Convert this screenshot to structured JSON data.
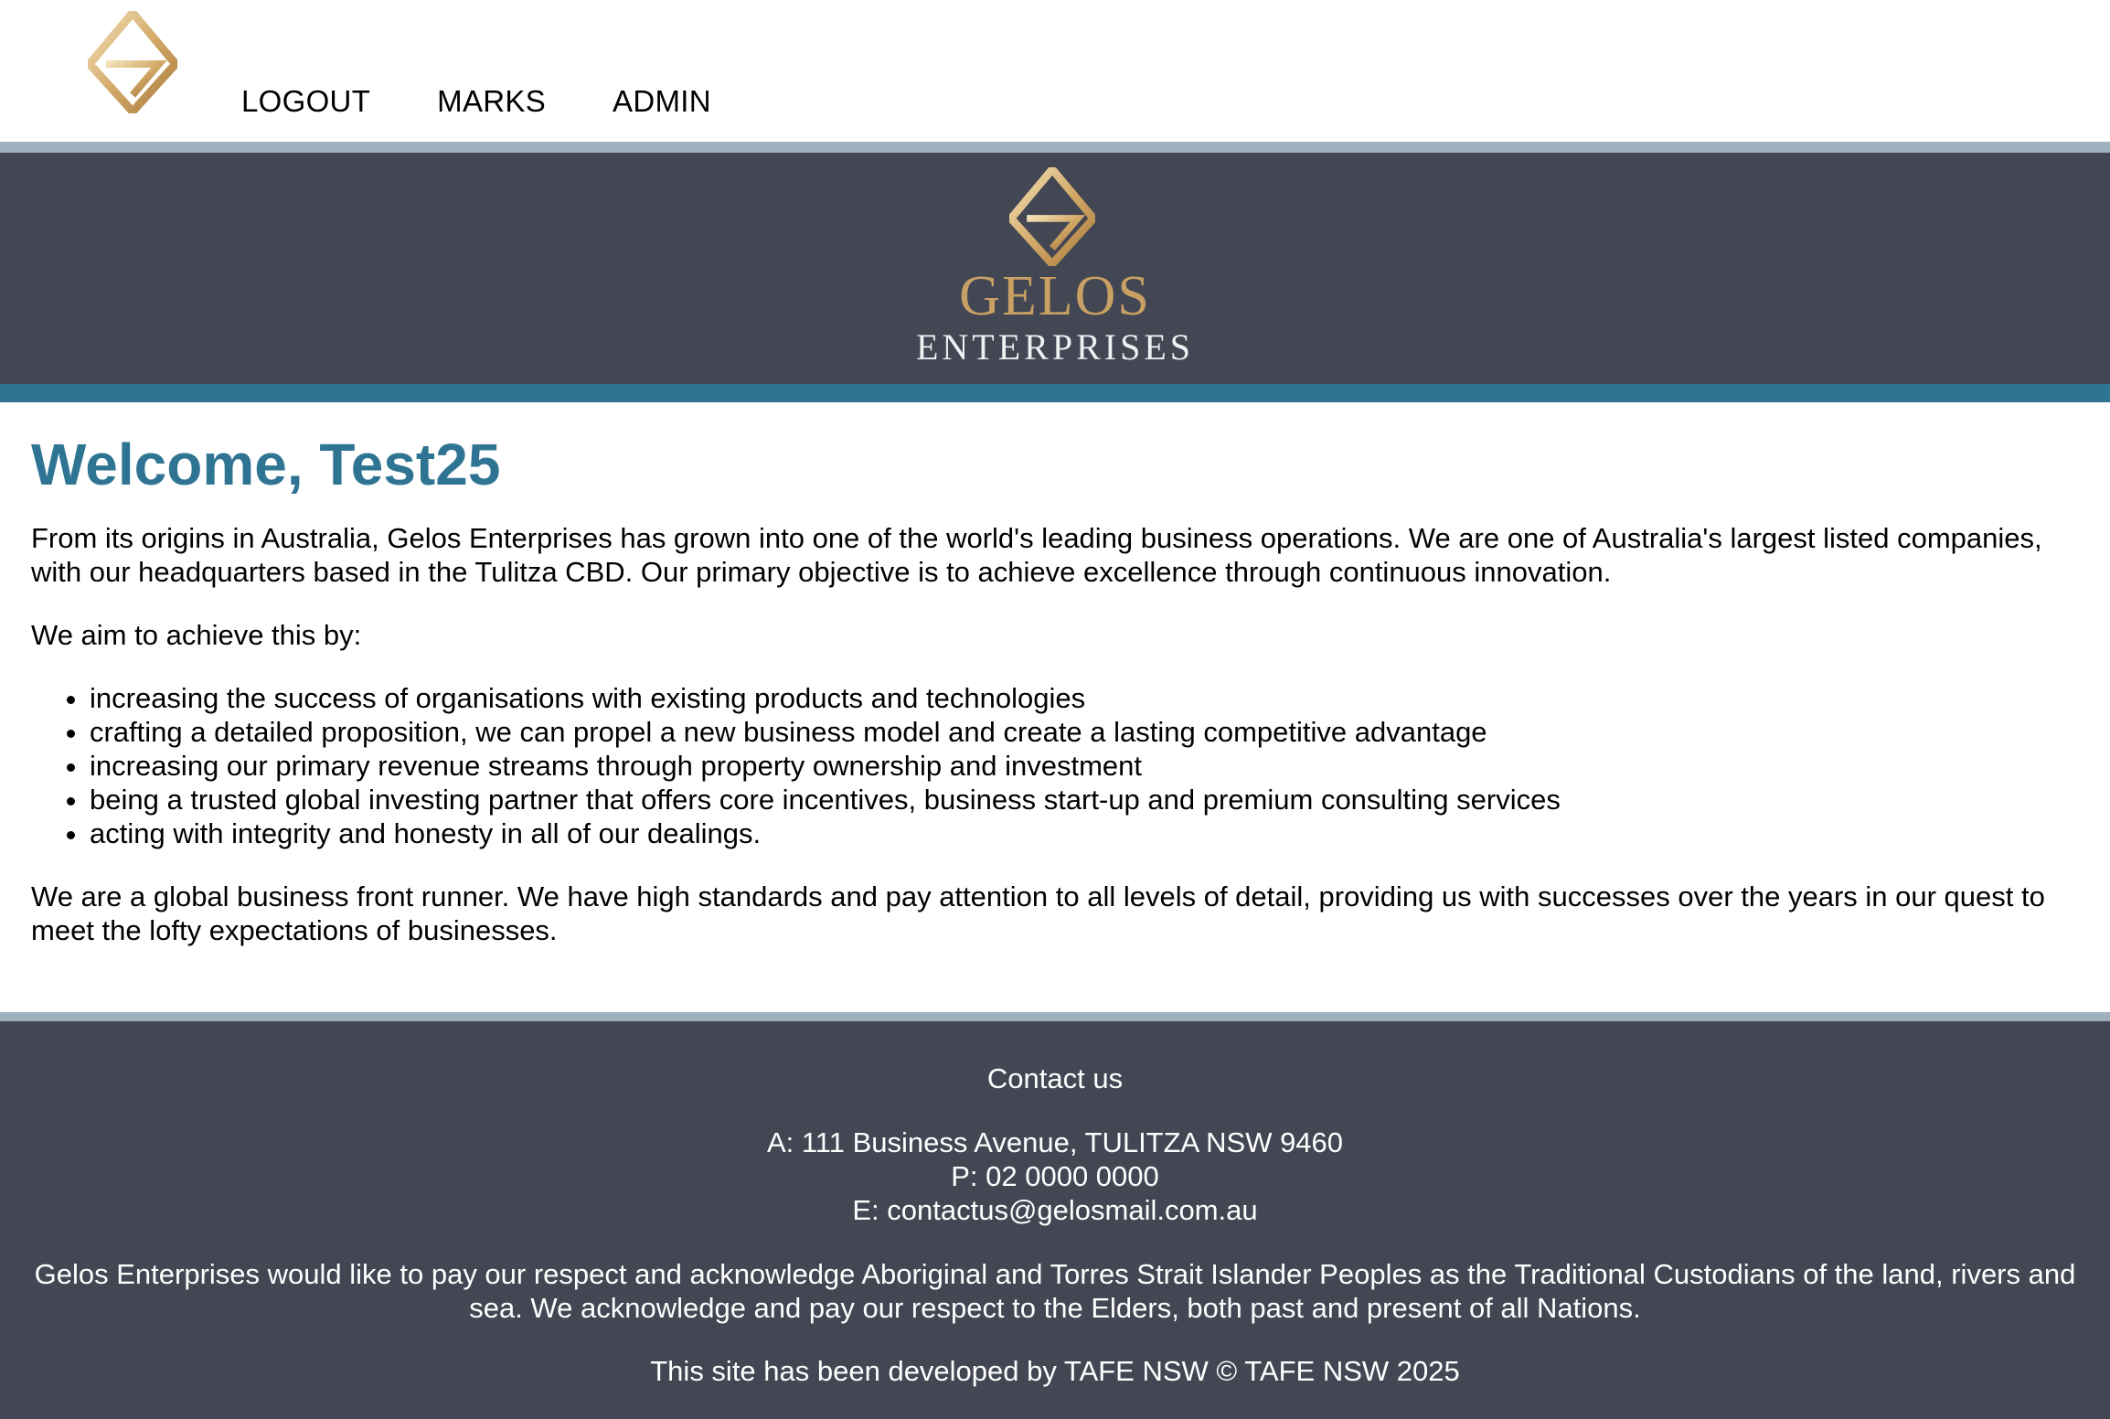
{
  "nav": {
    "logo_icon": "gelos-diamond-logo",
    "links": [
      "LOGOUT",
      "MARKS",
      "ADMIN"
    ]
  },
  "banner": {
    "logo_icon": "gelos-diamond-logo",
    "brand_name": "GELOS",
    "brand_sub": "ENTERPRISES"
  },
  "main": {
    "title": "Welcome, Test25",
    "intro": "From its origins in Australia, Gelos Enterprises has grown into one of the world's leading business operations. We are one of Australia's largest listed companies, with our headquarters based in the Tulitza CBD. Our primary objective is to achieve excellence through continuous innovation.",
    "aims_lead": "We aim to achieve this by:",
    "aims": [
      "increasing the success of organisations with existing products and technologies",
      "crafting a detailed proposition, we can propel a new business model and create a lasting competitive advantage",
      "increasing our primary revenue streams through property ownership and investment",
      "being a trusted global investing partner that offers core incentives, business start-up and premium consulting services",
      "acting with integrity and honesty in all of our dealings."
    ],
    "closing": "We are a global business front runner. We have high standards and pay attention to all levels of detail, providing us with successes over the years in our quest to meet the lofty expectations of businesses."
  },
  "footer": {
    "heading": "Contact us",
    "address": "A: 111 Business Avenue, TULITZA NSW 9460",
    "phone": "P: 02 0000 0000",
    "email": "E: contactus@gelosmail.com.au",
    "acknowledgement": "Gelos Enterprises would like to pay our respect and acknowledge Aboriginal and Torres Strait Islander Peoples as the Traditional Custodians of the land, rivers and sea. We acknowledge and pay our respect to the Elders, both past and present of all Nations.",
    "credit": "This site has been developed by TAFE NSW © TAFE NSW 2025"
  },
  "colors": {
    "accent_teal": "#2f7593",
    "banner_dark": "#434753",
    "band_light": "#9fb0bf",
    "logo_gold": "#c9a064"
  }
}
